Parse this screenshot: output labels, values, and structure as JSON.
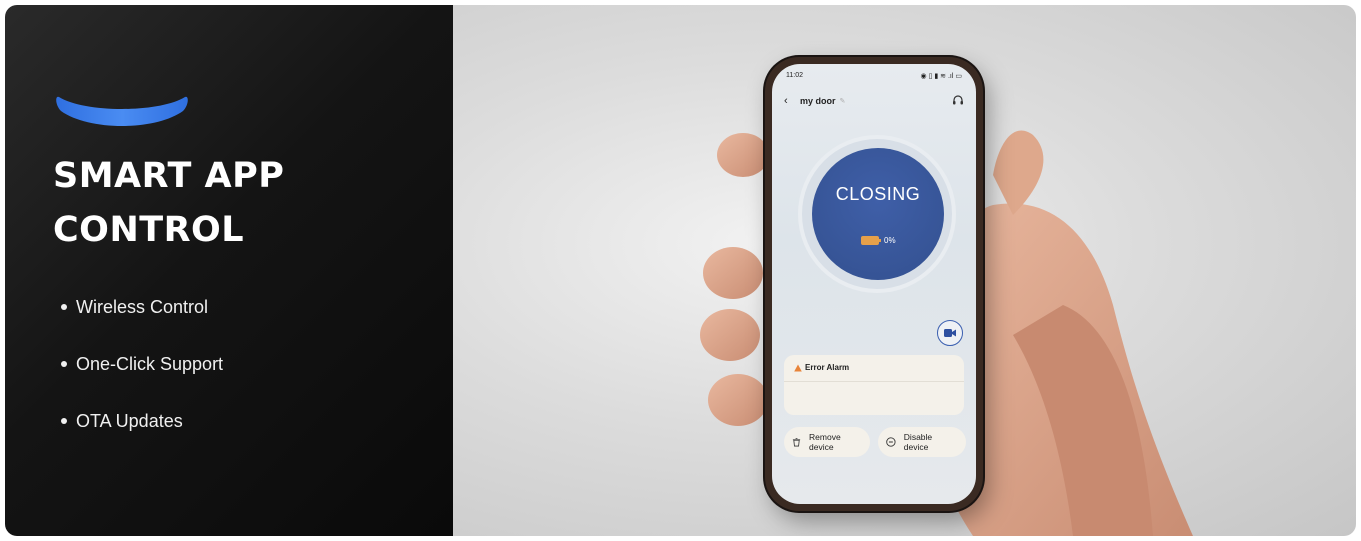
{
  "promo": {
    "headline_line1": "SMART APP",
    "headline_line2": "CONTROL",
    "features": [
      "Wireless Control",
      "One-Click Support",
      "OTA Updates"
    ],
    "accent_color": "#3a7de8"
  },
  "phone": {
    "status_bar": {
      "time": "11:02",
      "right_icons": "◉ ▯ ▮ ≋ .ıl ▭"
    },
    "header": {
      "title": "my door",
      "back_icon": "chevron-left-icon",
      "edit_icon": "pencil-icon",
      "support_icon": "headset-icon"
    },
    "door_status": {
      "label": "CLOSING",
      "battery_percent": "0%",
      "circle_color": "#3a5a9c",
      "battery_color": "#e6a04a"
    },
    "video_icon": "video-camera-icon",
    "alarm": {
      "title": "Error Alarm",
      "icon": "warning-icon"
    },
    "actions": {
      "remove_label": "Remove device",
      "disable_label": "Disable device"
    }
  }
}
